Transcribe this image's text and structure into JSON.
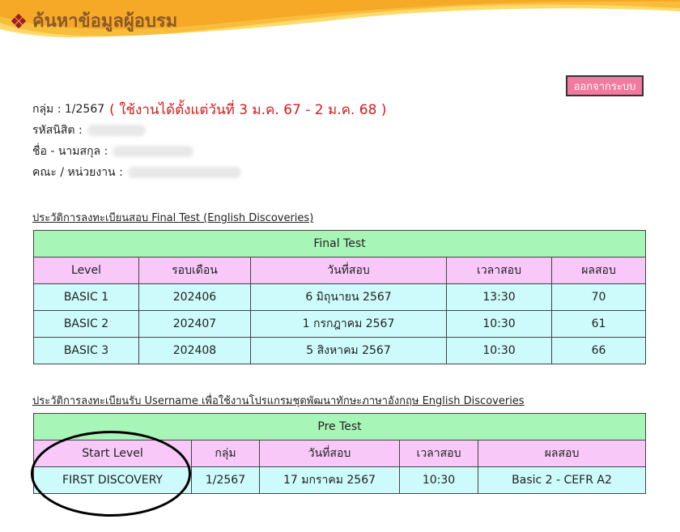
{
  "header": {
    "title": "ค้นหาข้อมูลผู้อบรม"
  },
  "logout_label": "ออกจากระบบ",
  "info": {
    "group_label": "กลุ่ม : 1/2567",
    "period": "( ใช้งานได้ตั้งแต่วันที่ 3 ม.ค. 67 - 2 ม.ค. 68 )",
    "student_id_label": "รหัสนิสิต :",
    "name_label": "ชื่อ - นามสกุล :",
    "faculty_label": "คณะ / หน่วยงาน :"
  },
  "final_test": {
    "caption": "ประวัติการลงทะเบียนสอบ Final Test (English Discoveries)",
    "title": "Final Test",
    "headers": [
      "Level",
      "รอบเดือน",
      "วันที่สอบ",
      "เวลาสอบ",
      "ผลสอบ"
    ],
    "rows": [
      [
        "BASIC 1",
        "202406",
        "6 มิถุนายน 2567",
        "13:30",
        "70"
      ],
      [
        "BASIC 2",
        "202407",
        "1 กรกฎาคม 2567",
        "10:30",
        "61"
      ],
      [
        "BASIC 3",
        "202408",
        "5 สิงหาคม 2567",
        "10:30",
        "66"
      ]
    ]
  },
  "pre_test": {
    "caption": "ประวัติการลงทะเบียนรับ Username เพื่อใช้งานโปรแกรมชุดพัฒนาทักษะภาษาอังกฤษ English Discoveries",
    "title": "Pre Test",
    "headers": [
      "Start Level",
      "กลุ่ม",
      "วันที่สอบ",
      "เวลาสอบ",
      "ผลสอบ"
    ],
    "rows": [
      [
        "FIRST DISCOVERY",
        "1/2567",
        "17 มกราคม 2567",
        "10:30",
        "Basic 2 - CEFR A2"
      ]
    ]
  },
  "colors": {
    "header_accent": "#f7a823",
    "title_text": "#8a5a2a",
    "period_text": "#d31c1c",
    "logout_bg": "#f27aa0",
    "table_title_bg": "#a8f5b8",
    "table_head_bg": "#f8c8f8",
    "table_row_bg": "#cdfafa"
  }
}
